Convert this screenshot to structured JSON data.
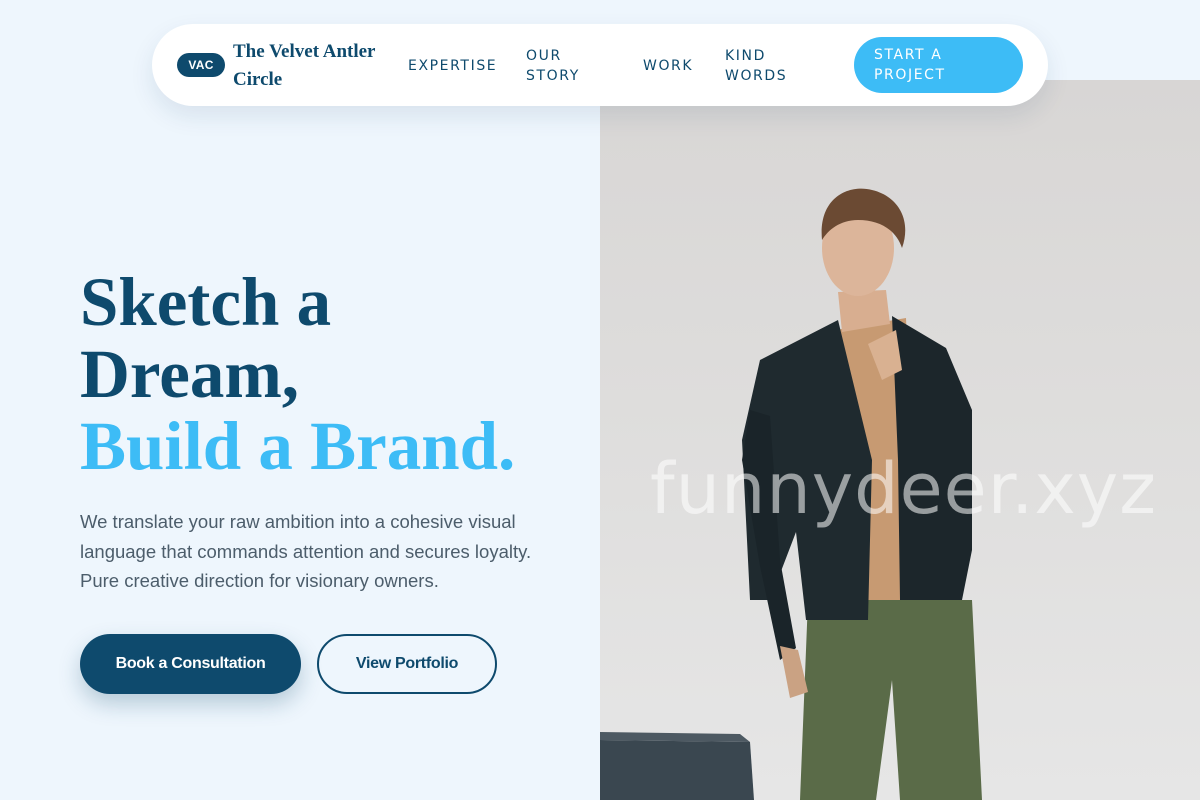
{
  "nav": {
    "badge": "VAC",
    "brand_name": "The Velvet Antler Circle",
    "links": [
      "EXPERTISE",
      "OUR STORY",
      "WORK",
      "KIND WORDS"
    ],
    "cta_label": "START A PROJECT"
  },
  "hero": {
    "headline_line1": "Sketch a",
    "headline_line2": "Dream,",
    "headline_accent": "Build a Brand.",
    "description": "We translate your raw ambition into a cohesive visual language that commands attention and secures loyalty. Pure creative direction for visionary owners.",
    "primary_button": "Book a Consultation",
    "secondary_button": "View Portfolio",
    "watermark": "funnydeer.xyz"
  },
  "colors": {
    "primary": "#0e4a6d",
    "accent": "#3dbcf6",
    "background": "#eef6fd"
  }
}
